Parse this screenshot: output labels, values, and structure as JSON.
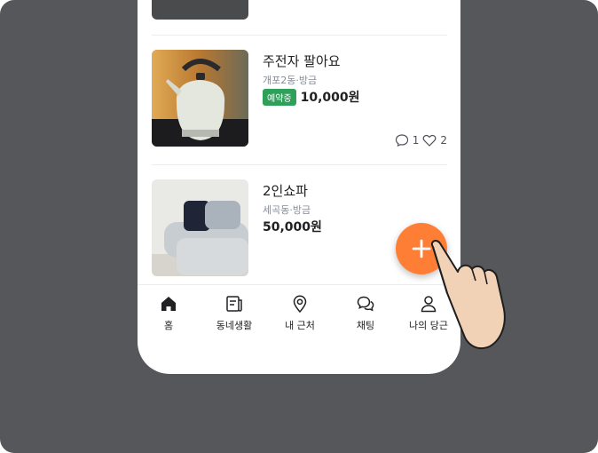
{
  "items": [
    {
      "title": "주전자 팔아요",
      "location": "개포2동",
      "time": "방금",
      "badge": "예약중",
      "price": "10,000원",
      "comments": "1",
      "likes": "2"
    },
    {
      "title": "2인쇼파",
      "location": "세곡동",
      "time": "방금",
      "price": "50,000원"
    }
  ],
  "tabs": [
    {
      "label": "홈",
      "icon": "home-icon"
    },
    {
      "label": "동네생활",
      "icon": "news-icon"
    },
    {
      "label": "내 근처",
      "icon": "location-pin-icon"
    },
    {
      "label": "채팅",
      "icon": "chat-icon"
    },
    {
      "label": "나의 당근",
      "icon": "person-icon"
    }
  ],
  "fab": {
    "icon": "plus-icon"
  },
  "colors": {
    "accent": "#ff7e36",
    "badge": "#2fa05a",
    "backdrop": "#55575a"
  }
}
